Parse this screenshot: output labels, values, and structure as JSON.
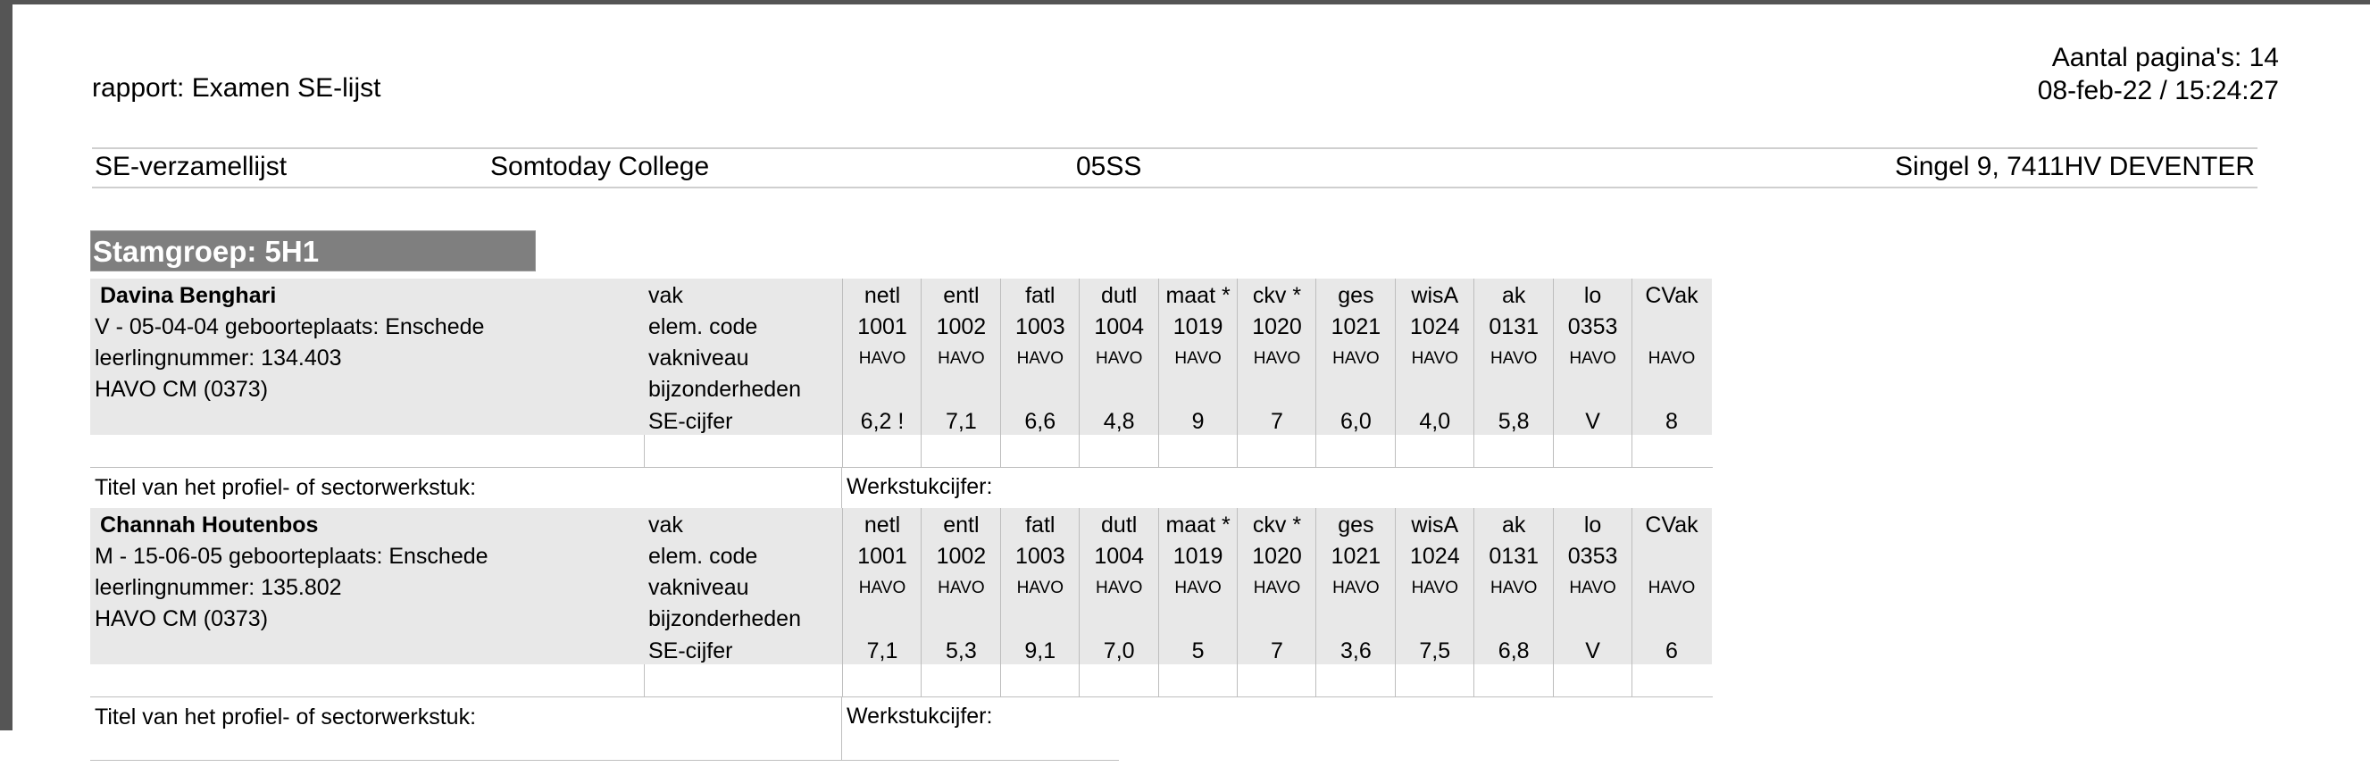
{
  "report": {
    "title": "rapport: Examen SE-lijst",
    "pages": "Aantal pagina's: 14",
    "datetime": "08-feb-22 / 15:24:27"
  },
  "header": {
    "list": "SE-verzamellijst",
    "school": "Somtoday College",
    "code": "05SS",
    "address": "Singel 9, 7411HV DEVENTER"
  },
  "group": {
    "label": "Stamgroep: 5H1"
  },
  "row_labels": {
    "vak": "vak",
    "code": "elem. code",
    "level": "vakniveau",
    "special": "bijzonderheden",
    "grade": "SE-cijfer"
  },
  "footer_labels": {
    "title": "Titel van het profiel- of sectorwerkstuk:",
    "grade": "Werkstukcijfer:"
  },
  "columns": [
    {
      "vak": "netl",
      "code": "1001",
      "level": "HAVO"
    },
    {
      "vak": "entl",
      "code": "1002",
      "level": "HAVO"
    },
    {
      "vak": "fatl",
      "code": "1003",
      "level": "HAVO"
    },
    {
      "vak": "dutl",
      "code": "1004",
      "level": "HAVO"
    },
    {
      "vak": "maat *",
      "code": "1019",
      "level": "HAVO"
    },
    {
      "vak": "ckv *",
      "code": "1020",
      "level": "HAVO"
    },
    {
      "vak": "ges",
      "code": "1021",
      "level": "HAVO"
    },
    {
      "vak": "wisA",
      "code": "1024",
      "level": "HAVO"
    },
    {
      "vak": "ak",
      "code": "0131",
      "level": "HAVO"
    },
    {
      "vak": "lo",
      "code": "0353",
      "level": "HAVO"
    },
    {
      "vak": "CVak",
      "code": "",
      "level": "HAVO"
    }
  ],
  "students": [
    {
      "name": "Davina  Benghari",
      "info": "V - 05-04-04 geboorteplaats: Enschede",
      "number": "leerlingnummer: 134.403",
      "profile": "HAVO CM (0373)",
      "grades": [
        "6,2 !",
        "7,1",
        "6,6",
        "4,8",
        "9",
        "7",
        "6,0",
        "4,0",
        "5,8",
        "V",
        "8"
      ]
    },
    {
      "name": "Channah  Houtenbos",
      "info": "M - 15-06-05 geboorteplaats: Enschede",
      "number": "leerlingnummer: 135.802",
      "profile": "HAVO CM (0373)",
      "grades": [
        "7,1",
        "5,3",
        "9,1",
        "7,0",
        "5",
        "7",
        "3,6",
        "7,5",
        "6,8",
        "V",
        "6"
      ]
    }
  ]
}
